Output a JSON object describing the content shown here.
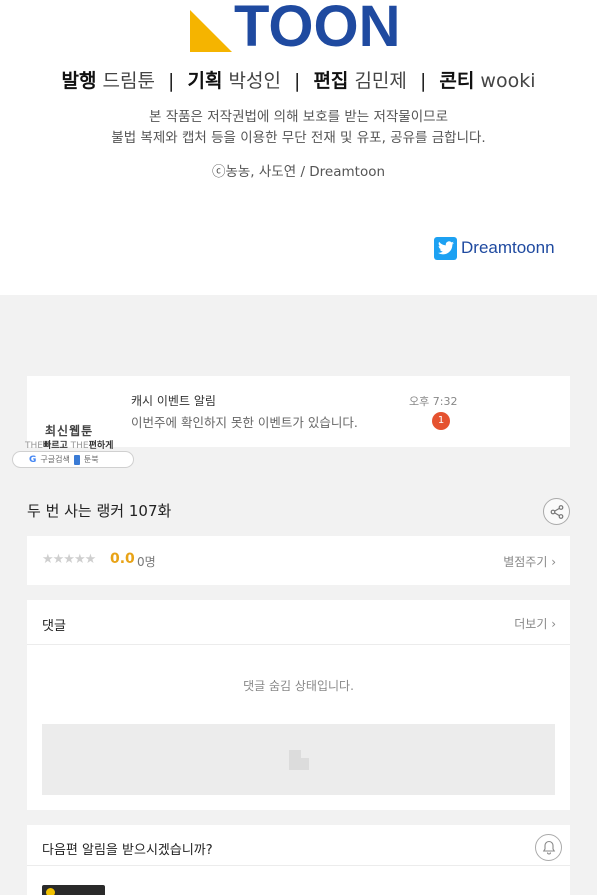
{
  "credits": {
    "logo_text": "TOON",
    "staff": [
      {
        "role": "발행",
        "name": "드림툰"
      },
      {
        "role": "기획",
        "name": "박성인"
      },
      {
        "role": "편집",
        "name": "김민제"
      },
      {
        "role": "콘티",
        "name": "wooki"
      }
    ],
    "separator": "|",
    "notice_line1": "본 작품은 저작권법에 의해 보호를 받는 저작물이므로",
    "notice_line2": "불법 복제와 캡처 등을 이용한 무단 전재 및 유포, 공유를 금합니다.",
    "copyright": "ⓒ농농, 사도연 / Dreamtoon",
    "twitter_handle": "Dreamtoonn",
    "colors": {
      "logo_blue": "#1f4aa0",
      "logo_yellow": "#f5b400",
      "twitter": "#1da1f2"
    }
  },
  "notification": {
    "title": "캐시 이벤트 알림",
    "message": "이번주에 확인하지 못한 이벤트가 있습니다.",
    "time": "오후 7:32",
    "badge": "1"
  },
  "brand": {
    "name": "최신웹툰",
    "tag_prefix1": "THE",
    "tag_word1": "빠르고",
    "tag_prefix2": "THE",
    "tag_word2": "편하게",
    "pill_google": "G",
    "pill_google_label": "구글검색",
    "pill_book_label": "툰북"
  },
  "episode": {
    "title": "두 번 사는 랭커 107화",
    "share_icon": "share-icon"
  },
  "rating": {
    "stars": "★★★★★",
    "stars_filled": 0,
    "score": "0.0",
    "count": "0명",
    "rate_link": "별점주기 ›"
  },
  "comments": {
    "title": "댓글",
    "more": "더보기 ›",
    "hidden_message": "댓글 숨김 상태입니다."
  },
  "next_alert": {
    "question": "다음편 알림을 받으시겠습니까?",
    "bell_icon": "bell-icon"
  }
}
